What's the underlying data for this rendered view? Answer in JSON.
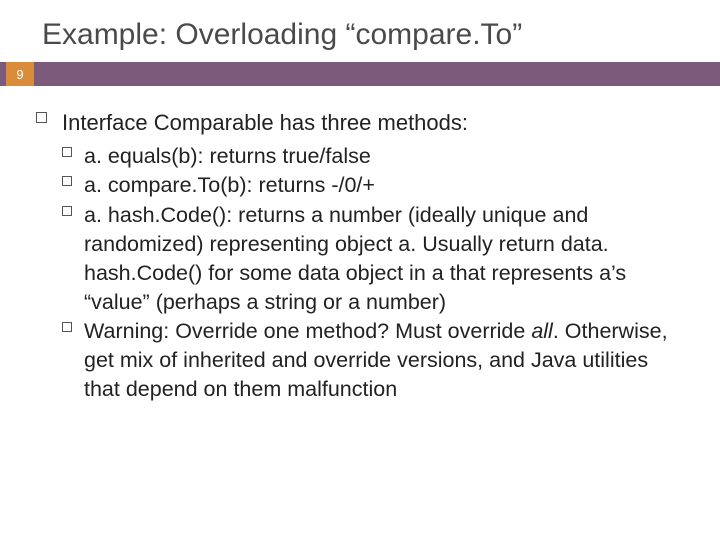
{
  "slide": {
    "title": "Example: Overloading “compare.To”",
    "page_number": "9",
    "main_bullet": "Interface Comparable has three methods:",
    "sub_bullets": [
      {
        "lead": "a. equals(b):",
        "rest": " returns true/false"
      },
      {
        "lead": "a. compare.To(b):",
        "rest": " returns -/0/+"
      },
      {
        "lead": "a. hash.Code():",
        "rest": " returns a number (ideally unique and randomized) representing object a.  Usually return data. hash.Code() for some data object in a that represents a’s “value” (perhaps a string or a number)"
      },
      {
        "lead": "Warning:",
        "rest_pre": " Override one method? Must override ",
        "rest_ital": "all",
        "rest_post": ". Otherwise, get mix of inherited and override versions, and Java utilities that depend on them malfunction"
      }
    ]
  }
}
